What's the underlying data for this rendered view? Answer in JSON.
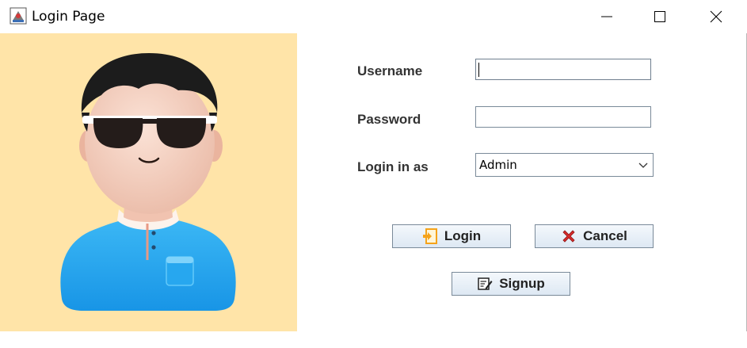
{
  "window": {
    "title": "Login Page",
    "controls": {
      "minimize": "minimize",
      "maximize": "maximize",
      "close": "close"
    }
  },
  "avatar": {
    "description_icon": "user-avatar-icon",
    "background_color": "#ffe4a8"
  },
  "form": {
    "username_label": "Username",
    "username_value": "",
    "password_label": "Password",
    "password_value": "",
    "role_label": "Login in as",
    "role_selected": "Admin"
  },
  "buttons": {
    "login_label": "Login",
    "login_icon": "login-arrow-icon",
    "cancel_label": "Cancel",
    "cancel_icon": "red-x-icon",
    "signup_label": "Signup",
    "signup_icon": "edit-form-icon"
  },
  "colors": {
    "button_gradient_top": "#f4f8fc",
    "button_gradient_bottom": "#dde8f3",
    "field_border": "#7a8a99",
    "cancel_icon_red": "#d62b2b",
    "login_icon_orange": "#f5a31a",
    "shirt_blue": "#2aa9ee"
  }
}
